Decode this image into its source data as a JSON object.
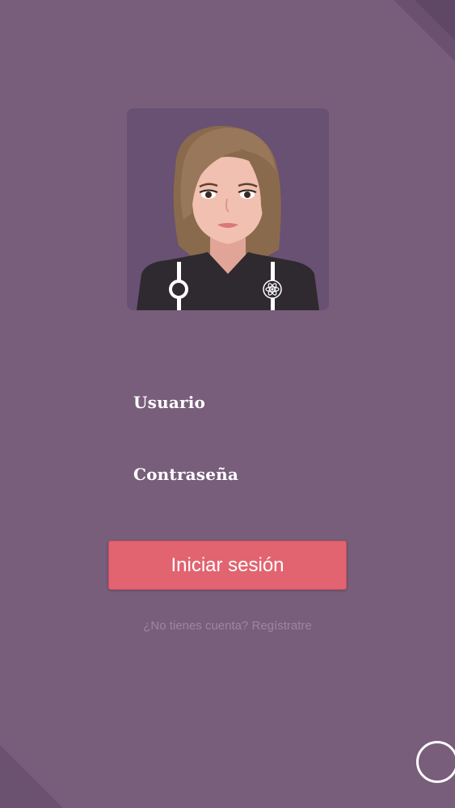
{
  "login": {
    "username_label": "Usuario",
    "username_value": "",
    "password_label": "Contraseña",
    "password_value": "",
    "submit_label": "Iniciar sesión",
    "register_prompt": "¿No tienes cuenta? Regístratre"
  },
  "avatar": {
    "icon": "female-avatar-illustration"
  },
  "floating_button": {
    "icon": "circle-outline-icon"
  },
  "colors": {
    "background": "#785e7b",
    "avatar_background": "#685172",
    "button": "#e16470",
    "link": "#9b86a0",
    "text": "#ffffff"
  }
}
